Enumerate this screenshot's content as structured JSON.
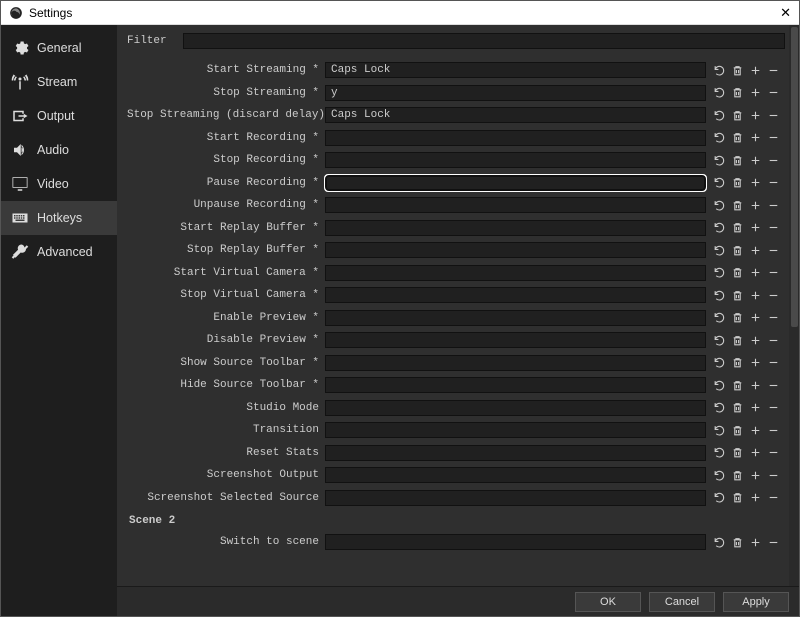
{
  "window": {
    "title": "Settings",
    "close": "✕"
  },
  "sidebar": {
    "items": [
      {
        "label": "General",
        "icon": "gear-icon"
      },
      {
        "label": "Stream",
        "icon": "antenna-icon"
      },
      {
        "label": "Output",
        "icon": "output-icon"
      },
      {
        "label": "Audio",
        "icon": "speaker-icon"
      },
      {
        "label": "Video",
        "icon": "monitor-icon"
      },
      {
        "label": "Hotkeys",
        "icon": "keyboard-icon",
        "active": true
      },
      {
        "label": "Advanced",
        "icon": "tools-icon"
      }
    ]
  },
  "filter": {
    "label": "Filter",
    "value": ""
  },
  "hotkeys": {
    "rows": [
      {
        "label": "Start Streaming *",
        "value": "Caps Lock"
      },
      {
        "label": "Stop Streaming *",
        "value": "y"
      },
      {
        "label": "Stop Streaming (discard delay)",
        "value": "Caps Lock"
      },
      {
        "label": "Start Recording *",
        "value": ""
      },
      {
        "label": "Stop Recording *",
        "value": ""
      },
      {
        "label": "Pause Recording *",
        "value": ""
      },
      {
        "label": "Unpause Recording *",
        "value": ""
      },
      {
        "label": "Start Replay Buffer *",
        "value": ""
      },
      {
        "label": "Stop Replay Buffer *",
        "value": ""
      },
      {
        "label": "Start Virtual Camera *",
        "value": ""
      },
      {
        "label": "Stop Virtual Camera *",
        "value": ""
      },
      {
        "label": "Enable Preview *",
        "value": ""
      },
      {
        "label": "Disable Preview *",
        "value": ""
      },
      {
        "label": "Show Source Toolbar *",
        "value": ""
      },
      {
        "label": "Hide Source Toolbar *",
        "value": ""
      },
      {
        "label": "Studio Mode",
        "value": ""
      },
      {
        "label": "Transition",
        "value": ""
      },
      {
        "label": "Reset Stats",
        "value": ""
      },
      {
        "label": "Screenshot Output",
        "value": ""
      },
      {
        "label": "Screenshot Selected Source",
        "value": ""
      }
    ]
  },
  "scene_section": {
    "title": "Scene 2",
    "rows": [
      {
        "label": "Switch to scene",
        "value": ""
      }
    ]
  },
  "footer": {
    "ok": "OK",
    "cancel": "Cancel",
    "apply": "Apply"
  },
  "focused_row_index": 5
}
